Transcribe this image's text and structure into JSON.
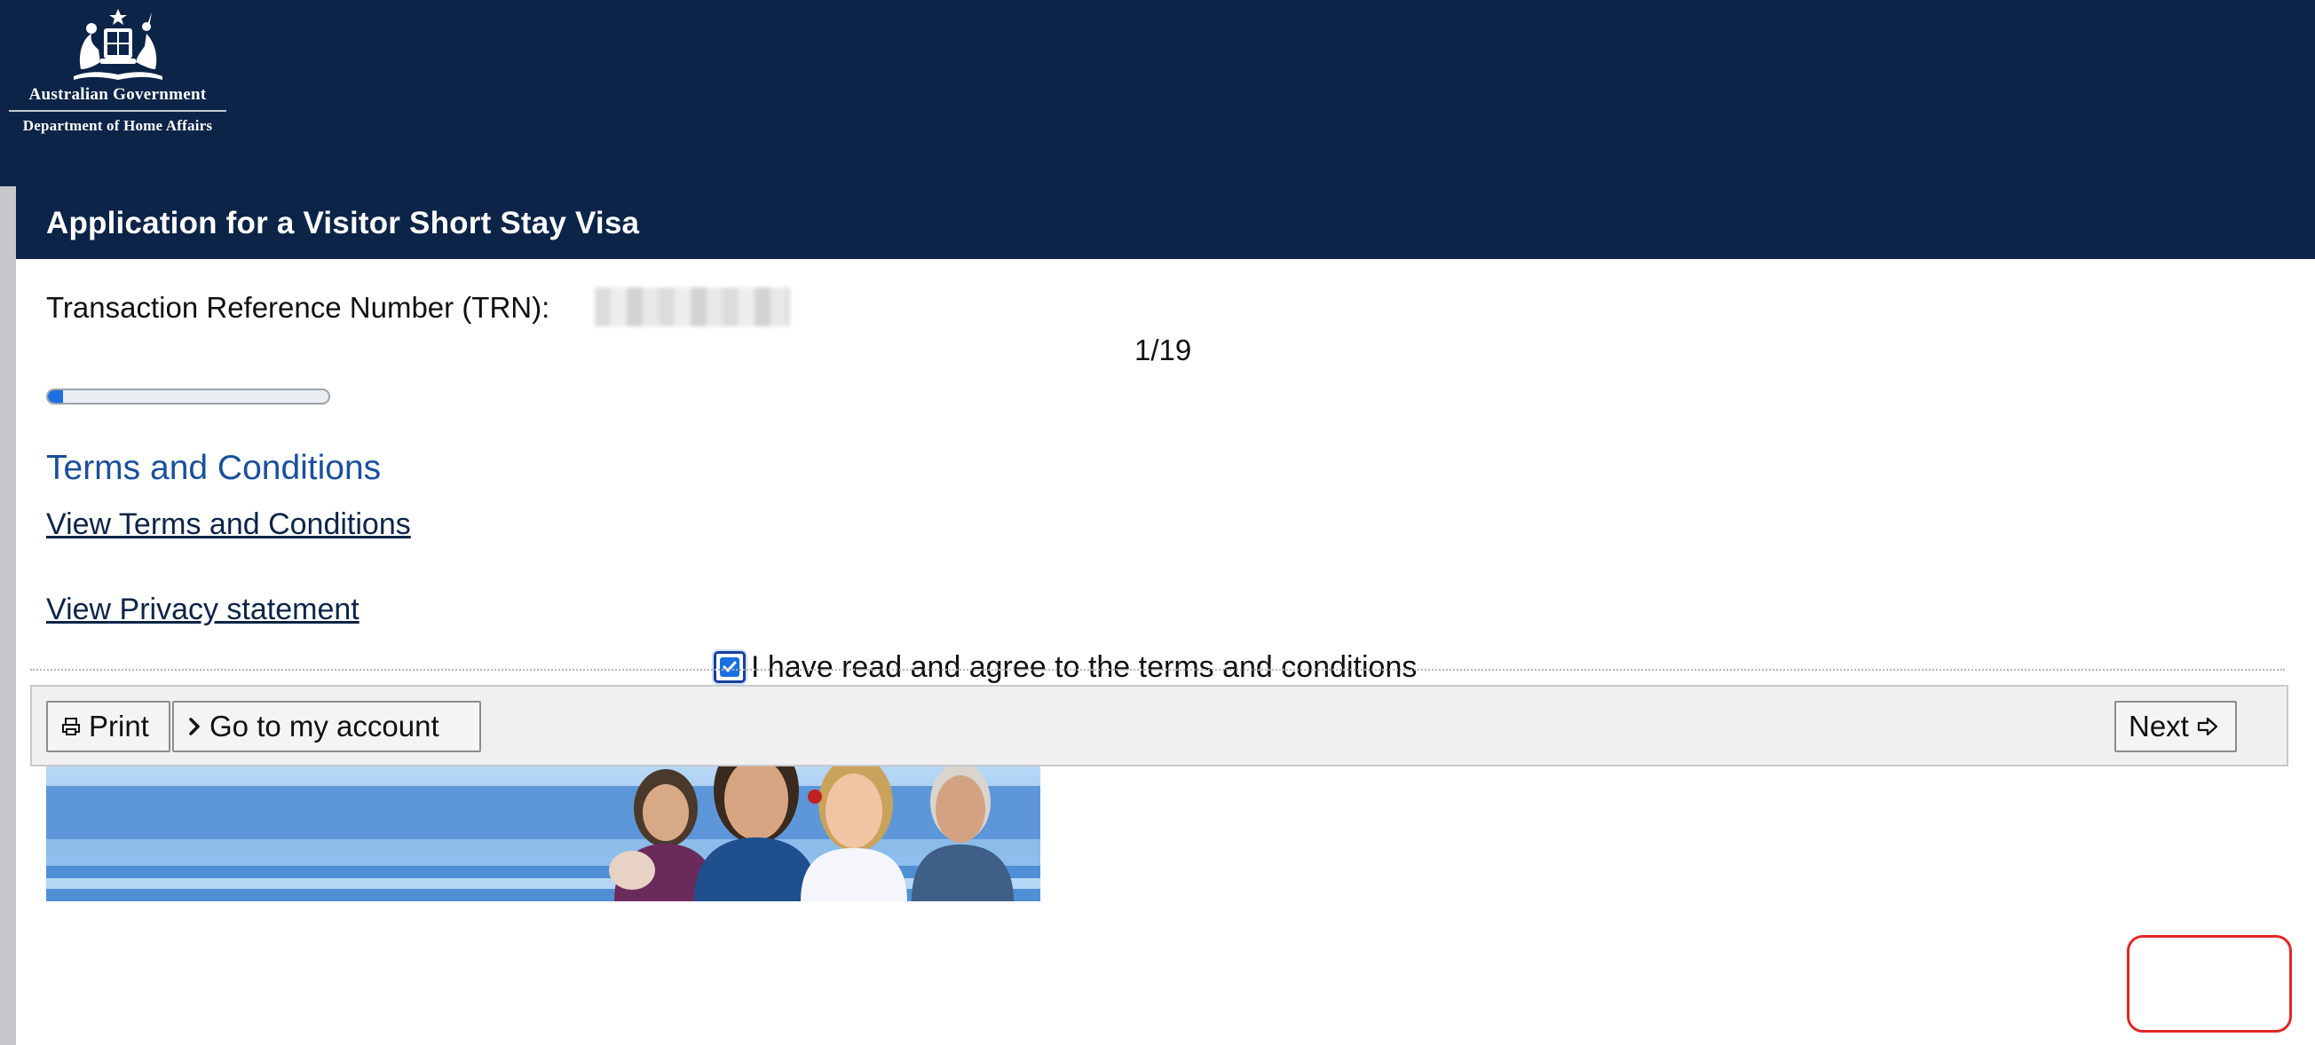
{
  "header": {
    "logo_line1": "Australian Government",
    "logo_line2": "Department of Home Affairs",
    "background_color": "#0c2447"
  },
  "page": {
    "title": "Application for a Visitor Short Stay Visa",
    "trn_label": "Transaction Reference Number (TRN):",
    "page_indicator": "1/19",
    "progress_fraction": 0.0526
  },
  "terms": {
    "heading": "Terms and Conditions",
    "view_terms_link": "View Terms and Conditions",
    "view_privacy_link": "View Privacy statement",
    "agree_label": "I have read and agree to the terms and conditions",
    "agree_checked": true
  },
  "footer": {
    "print_label": "Print",
    "account_label": "Go to my account",
    "next_label": "Next"
  },
  "icons": {
    "logo": "coat-of-arms-icon",
    "print": "printer-icon",
    "account": "chevron-right-icon",
    "next": "arrow-right-icon",
    "checkbox": "checkmark-icon"
  },
  "colors": {
    "heading_blue": "#1a4f9c",
    "progress_blue": "#1b6fe0",
    "highlight_red": "#e32626"
  }
}
